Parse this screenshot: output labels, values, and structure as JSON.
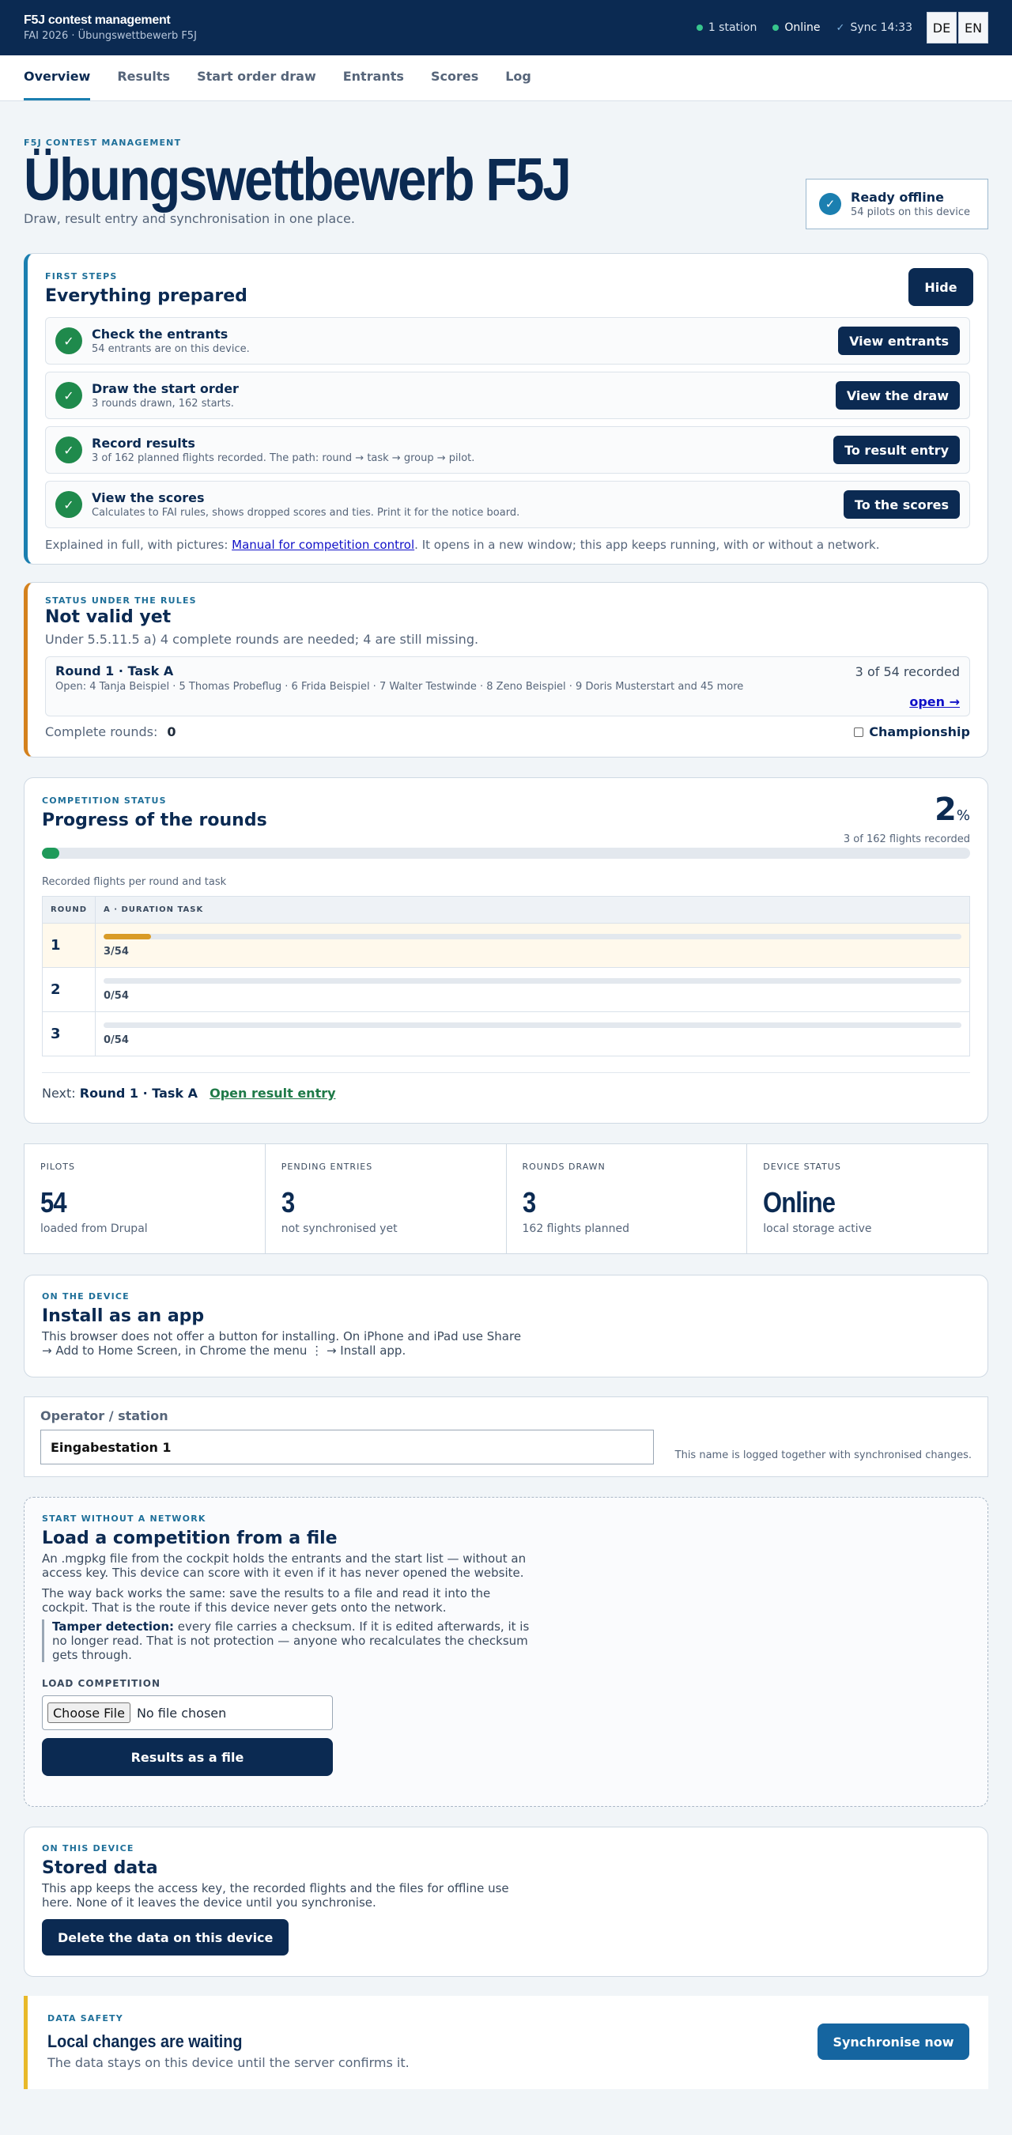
{
  "header": {
    "app_title": "F5J contest management",
    "subtitle": "FAI 2026 · Übungswettbewerb F5J",
    "stations": "1 station",
    "online": "Online",
    "sync": "Sync 14:33",
    "lang": [
      "DE",
      "EN"
    ]
  },
  "tabs": [
    "Overview",
    "Results",
    "Start order draw",
    "Entrants",
    "Scores",
    "Log"
  ],
  "hero": {
    "eyebrow": "F5J contest management",
    "title": "Übungswettbewerb F5J",
    "subtitle": "Draw, result entry and synchronisation in one place.",
    "offline_title": "Ready offline",
    "offline_sub": "54 pilots on this device"
  },
  "first_steps": {
    "eyebrow": "First steps",
    "title": "Everything prepared",
    "hide": "Hide",
    "steps": [
      {
        "title": "Check the entrants",
        "desc": "54 entrants are on this device.",
        "button": "View entrants"
      },
      {
        "title": "Draw the start order",
        "desc": "3 rounds drawn, 162 starts.",
        "button": "View the draw"
      },
      {
        "title": "Record results",
        "desc": "3 of 162 planned flights recorded. The path: round → task → group → pilot.",
        "button": "To result entry"
      },
      {
        "title": "View the scores",
        "desc": "Calculates to FAI rules, shows dropped scores and ties. Print it for the notice board.",
        "button": "To the scores"
      }
    ],
    "manual_pre": "Explained in full, with pictures: ",
    "manual_link": "Manual for competition control",
    "manual_post": ". It opens in a new window; this app keeps running, with or without a network."
  },
  "validity": {
    "eyebrow": "Status under the rules",
    "title": "Not valid yet",
    "subtitle": "Under 5.5.11.5 a) 4 complete rounds are needed; 4 are still missing.",
    "round_title": "Round 1 · Task A",
    "round_recorded": "3 of 54 recorded",
    "round_open": "Open: 4 Tanja Beispiel · 5 Thomas Probeflug · 6 Frida Beispiel · 7 Walter Testwinde · 8 Zeno Beispiel · 9 Doris Musterstart and 45 more",
    "round_link": "open →",
    "complete_label": "Complete rounds:",
    "complete_value": "0",
    "championship": "Championship"
  },
  "progress": {
    "eyebrow": "Competition status",
    "title": "Progress of the rounds",
    "percent": "2",
    "percent_sign": "%",
    "overall_fraction": 0.0185,
    "flights": "3 of 162 flights recorded",
    "per_round_label": "Recorded flights per round and task",
    "col_round": "Round",
    "col_task": "A · Duration task",
    "rows": [
      {
        "round": "1",
        "label": "3/54",
        "fraction": 0.0556
      },
      {
        "round": "2",
        "label": "0/54",
        "fraction": 0
      },
      {
        "round": "3",
        "label": "0/54",
        "fraction": 0
      }
    ],
    "next_label": "Next:",
    "next_value": "Round 1 · Task A",
    "next_link": "Open result entry"
  },
  "kpis": [
    {
      "label": "Pilots",
      "value": "54",
      "desc": "loaded from Drupal"
    },
    {
      "label": "Pending entries",
      "value": "3",
      "desc": "not synchronised yet"
    },
    {
      "label": "Rounds drawn",
      "value": "3",
      "desc": "162 flights planned"
    },
    {
      "label": "Device status",
      "value": "Online",
      "desc": "local storage active"
    }
  ],
  "install": {
    "eyebrow": "On the device",
    "title": "Install as an app",
    "text": "This browser does not offer a button for installing. On iPhone and iPad use Share → Add to Home Screen, in Chrome the menu ⋮ → Install app."
  },
  "operator": {
    "label": "Operator / station",
    "value": "Eingabestation 1",
    "note": "This name is logged together with synchronised changes."
  },
  "load": {
    "eyebrow": "Start without a network",
    "title": "Load a competition from a file",
    "p1": "An .mgpkg file from the cockpit holds the entrants and the start list — without an access key. This device can score with it even if it has never opened the website.",
    "p2": "The way back works the same: save the results to a file and read it into the cockpit. That is the route if this device never gets onto the network.",
    "tamper_label": "Tamper detection:",
    "tamper_text": " every file carries a checksum. If it is edited afterwards, it is no longer read. That is not protection — anyone who recalculates the checksum gets through.",
    "load_label": "Load competition",
    "choose": "Choose File",
    "no_file": "No file chosen",
    "results_button": "Results as a file"
  },
  "stored": {
    "eyebrow": "On this device",
    "title": "Stored data",
    "text": "This app keeps the access key, the recorded flights and the files for offline use here. None of it leaves the device until you synchronise.",
    "delete_button": "Delete the data on this device"
  },
  "safety": {
    "eyebrow": "Data safety",
    "title": "Local changes are waiting",
    "text": "The data stays on this device until the server confirms it.",
    "sync_button": "Synchronise now"
  }
}
